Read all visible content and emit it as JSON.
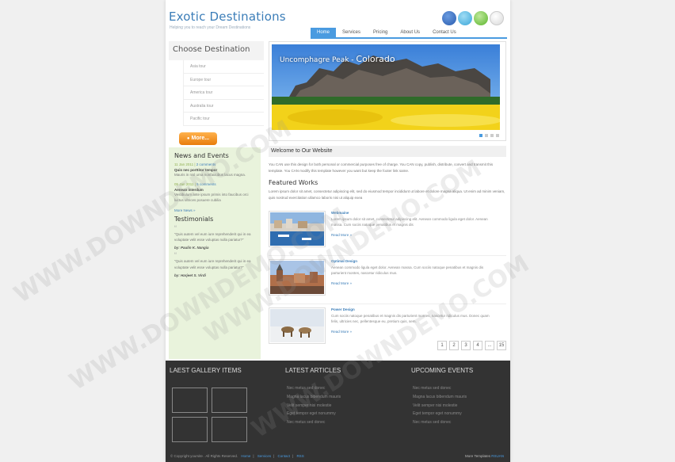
{
  "header": {
    "logo": "Exotic Destinations",
    "tagline": "Helping you to reach your Dream Destinations",
    "social": [
      "facebook-icon",
      "twitter-icon",
      "myspace-icon",
      "youtube-icon"
    ]
  },
  "nav": [
    "Home",
    "Services",
    "Pricing",
    "About Us",
    "Contact Us"
  ],
  "sidebar": {
    "choose_title": "Choose Destination",
    "tours": [
      "Asia tour",
      "Europe tour",
      "America tour",
      "Australia tour",
      "Pacific tour"
    ],
    "more_button": "More...",
    "search_placeholder": "",
    "news_title": "News and Events",
    "news": [
      {
        "date": "11 Jan 2011",
        "comments": "2 comments",
        "title": "Quis nec porttitor tempor",
        "text": "Mauris in nisl urna nonfaucibus lacus magna."
      },
      {
        "date": "05 Jan 2011",
        "comments": "5 comments",
        "title": "Aenean interdum",
        "text": "Vestibulum ante ipsum primis into faucibus orci luctus ultrices posuere cubilia"
      }
    ],
    "more_news": "More News »",
    "testimonials_title": "Testimonials",
    "testimonials": [
      {
        "text": "“Quis autem vel eum iure reprehenderit qui in ea voluptate velit esse voluptas nulla pariatur?”",
        "by": "by: Paulin K. Nangia"
      },
      {
        "text": "“Quis autem vel eum iure reprehenderit qui in ea voluptate velit esse voluptas nulla pariatur?”",
        "by": "by: Harjeet S. Virdi"
      }
    ]
  },
  "slider": {
    "title_small": "Uncomphagre Peak - ",
    "title_big": "Colorado"
  },
  "welcome": {
    "title": "Welcome to Our Website",
    "text": "You CAN use this design for both personal or commercial purposes free of charge. You CAN copy, publish, distribute, convert and transmit this template. You CAN modify this template however you want but keep the footer link same."
  },
  "featured": {
    "title": "Featured Works",
    "text": "Lorem ipsum dolor sit amet, consectetur adipiscing elit, sed do eiusmod tempor incididunt ut labore et dolore magna aliqua. Ut enim ad minim veniam, quis nostrud exercitation ullamco laboris nisi ut aliquip exea",
    "items": [
      {
        "title": "Webmaine",
        "text": "Lorem ipsum dolor sit amet, consectetur adipiscing elit. Aenean commodo ligula eget dolor. Aenean massa. Cum sociis natoque penatibus et magnis dis",
        "more": "Read More »"
      },
      {
        "title": "Optimal Design",
        "text": "Aenean commodo ligula eget dolor. Aenean massa. Cum sociis natoque penatibus et magnis dis parturient montes, nascetur ridiculus mus.",
        "more": "Read More »"
      },
      {
        "title": "Power Design",
        "text": "Cum sociis natoque penatibus et magnis dis parturient montes, nascetur ridiculus mus. Donec quam felis, ultricies nec, pellentesque eu, pretium quis, sem.",
        "more": "Read More »"
      }
    ]
  },
  "pager": [
    "1",
    "2",
    "3",
    "4",
    "...",
    "15"
  ],
  "footer": {
    "gallery_title": "LAEST GALLERY ITEMS",
    "articles_title": "LATEST ARTICLES",
    "events_title": "UPCOMING EVENTS",
    "articles": [
      "Nec metus sed donec",
      "Magna lacus bibendum mauris",
      "Velit semper nisi molestie",
      "Eget tempor eget nonummy",
      "Nec metus sed donec"
    ],
    "events": [
      "Nec metus sed donec",
      "Magna lacus bibendum mauris",
      "Velit semper nisi molestie",
      "Eget tempor eget nonummy",
      "Nec metus sed donec"
    ],
    "copyright": "© Copyright yoursite . All Rights Reserved.",
    "links": [
      "Home",
      "Services",
      "Contact",
      "RSS"
    ],
    "credit_label": "More Templates",
    "credit_link": "RSUAN"
  },
  "watermark": "WWW.DOWNDEMO.COM"
}
